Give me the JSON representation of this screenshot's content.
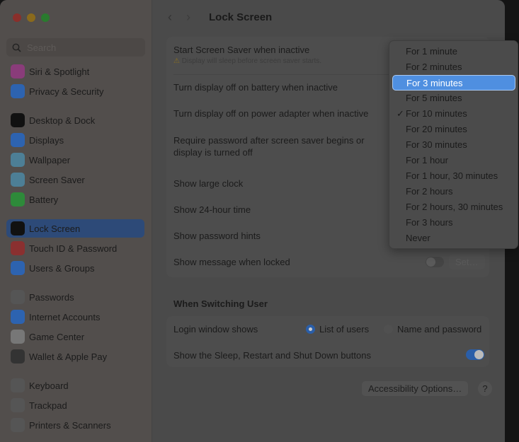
{
  "window": {
    "title": "Lock Screen"
  },
  "sidebar": {
    "search_placeholder": "Search",
    "items": [
      {
        "label": "Siri & Spotlight",
        "color": "#8a3c7a"
      },
      {
        "label": "Privacy & Security",
        "color": "#2d63b0"
      },
      {
        "label": "Desktop & Dock",
        "color": "#111111"
      },
      {
        "label": "Displays",
        "color": "#2d63b0"
      },
      {
        "label": "Wallpaper",
        "color": "#4d7f96"
      },
      {
        "label": "Screen Saver",
        "color": "#4d7f96"
      },
      {
        "label": "Battery",
        "color": "#2e8a3a"
      },
      {
        "label": "Lock Screen",
        "color": "#111111",
        "selected": true
      },
      {
        "label": "Touch ID & Password",
        "color": "#8a3030"
      },
      {
        "label": "Users & Groups",
        "color": "#2d63b0"
      },
      {
        "label": "Passwords",
        "color": "#555555"
      },
      {
        "label": "Internet Accounts",
        "color": "#2d63b0"
      },
      {
        "label": "Game Center",
        "color": "#777777"
      },
      {
        "label": "Wallet & Apple Pay",
        "color": "#333333"
      },
      {
        "label": "Keyboard",
        "color": "#555555"
      },
      {
        "label": "Trackpad",
        "color": "#555555"
      },
      {
        "label": "Printers & Scanners",
        "color": "#555555"
      }
    ]
  },
  "settings": {
    "screen_saver": "Start Screen Saver when inactive",
    "screen_saver_warning": "Display will sleep before screen saver starts.",
    "battery": "Turn display off on battery when inactive",
    "power": "Turn display off on power adapter when inactive",
    "password": "Require password after screen saver begins or display is turned off",
    "large_clock": "Show large clock",
    "time24": "Show 24-hour time",
    "hints": "Show password hints",
    "message": "Show message when locked",
    "message_on": false,
    "set_label": "Set…"
  },
  "switching": {
    "heading": "When Switching User",
    "login_label": "Login window shows",
    "option1": "List of users",
    "option2": "Name and password",
    "selected": "List of users",
    "sleep_buttons": "Show the Sleep, Restart and Shut Down buttons",
    "sleep_on": true
  },
  "footer": {
    "accessibility": "Accessibility Options…",
    "help": "?"
  },
  "menu": {
    "items": [
      "For 1 minute",
      "For 2 minutes",
      "For 3 minutes",
      "For 5 minutes",
      "For 10 minutes",
      "For 20 minutes",
      "For 30 minutes",
      "For 1 hour",
      "For 1 hour, 30 minutes",
      "For 2 hours",
      "For 2 hours, 30 minutes",
      "For 3 hours",
      "Never"
    ],
    "highlighted": "For 3 minutes",
    "checked": "For 10 minutes",
    "check_mark": "✓"
  },
  "colors": {
    "accent": "#4f8fe0",
    "toggle_on": "#2a5ea8"
  }
}
